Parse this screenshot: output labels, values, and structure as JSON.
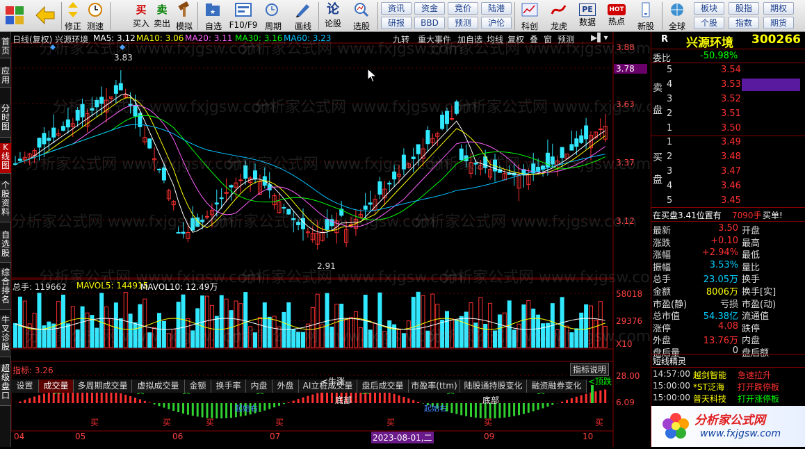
{
  "toolbar": {
    "buttons": [
      {
        "label": "",
        "name": "grid-icon"
      },
      {
        "label": "",
        "name": "back-arrow-icon"
      },
      {
        "label": "修正",
        "name": "updown-arrow-icon"
      },
      {
        "label": "测速",
        "name": "clock-icon"
      },
      {
        "label": "买入",
        "icon": "买",
        "name": "buy-icon"
      },
      {
        "label": "卖出",
        "icon": "卖",
        "name": "sell-icon"
      },
      {
        "label": "模拟",
        "name": "hammer-icon"
      },
      {
        "label": "自选",
        "name": "folder-star-icon"
      },
      {
        "label": "F10/F9",
        "name": "f10-icon"
      },
      {
        "label": "周期",
        "name": "cycle-icon"
      },
      {
        "label": "画线",
        "name": "pencil-icon"
      },
      {
        "label": "论股",
        "icon": "论",
        "name": "forum-icon"
      },
      {
        "label": "选股",
        "name": "magnifier-icon"
      }
    ],
    "navgrid": [
      [
        "资讯",
        "资金",
        "竞价",
        "陆港"
      ],
      [
        "研报",
        "BBD",
        "预测",
        "沪伦"
      ]
    ],
    "buttons2": [
      {
        "label": "科创",
        "name": "kechuang-icon"
      },
      {
        "label": "龙虎",
        "name": "dragon-icon"
      },
      {
        "label": "数据",
        "icon": "PE",
        "name": "pe-icon"
      },
      {
        "label": "热点",
        "icon": "HOT",
        "name": "hot-icon"
      },
      {
        "label": "新股",
        "name": "newstock-icon"
      },
      {
        "label": "全球",
        "name": "globe-icon"
      }
    ],
    "navgrid2": [
      [
        "板块",
        "股指",
        "期权"
      ],
      [
        "个股",
        "指数",
        "期货"
      ]
    ]
  },
  "lefttabs": [
    "首页",
    "应用",
    "分时图",
    "K线图",
    "个股资料",
    "自选股",
    "综合排名",
    "牛叉诊股",
    "超级盘口"
  ],
  "chart": {
    "legend": {
      "title": "日线(复权) 兴源环境",
      "ma5": "MA5: 3.12",
      "ma10": "MA10: 3.06",
      "ma20": "MA20: 3.11",
      "ma30": "MA30: 3.16",
      "ma60": "MA60: 3.23"
    },
    "topbtns": [
      "九转",
      "重大事件",
      "加自选",
      "均线",
      "复权",
      "叠",
      "窗",
      "预测"
    ],
    "price_axis": [
      "3.88",
      "3.78",
      "3.63",
      "3.37",
      "3.12"
    ],
    "high_label": "3.83",
    "low_label": "2.91",
    "vol_legend": {
      "total": "总手: 119662",
      "mavol5": "MAVOL5: 144915",
      "mavol10": "MAVOL10: 12.49万"
    },
    "vol_axis": [
      "58018",
      "29376",
      "X10"
    ],
    "tabs": [
      "设置",
      "成交量",
      "多周期成交量",
      "虚拟成交量",
      "金额",
      "换手率",
      "内盘",
      "外盘",
      "AI立桩成交量",
      "盘后成交量",
      "市盈率(ttm)",
      "陆股通持股变化",
      "融资融券变化"
    ],
    "ind_title": "指标: 3.26",
    "ind_btn": "指标说明",
    "ind_axis": [
      "28.00",
      "6.09"
    ],
    "dates": [
      "04",
      "05",
      "06",
      "07",
      "09",
      "10"
    ],
    "cursor_date": "2023-08-01,二",
    "signals": [
      "卖",
      "买",
      "卖",
      "买",
      "卖",
      "买",
      "卖",
      "买",
      "卖",
      "买",
      "卖",
      "买",
      "卖",
      "买",
      "卖"
    ],
    "annot": {
      "bull": "<牛涨",
      "bottom1": "底部",
      "bottom2": "底部",
      "start1": "起始右",
      "start2": "起始右",
      "top": "<顶跌"
    },
    "watermark": "分析家公式网 www.fxjgsw.com"
  },
  "right": {
    "r": "R",
    "name": "兴源环境",
    "code": "300266",
    "weibi_label": "委比",
    "weibi": "-50.98%",
    "sell_label": [
      "卖",
      "盘"
    ],
    "buy_label": [
      "买",
      "盘"
    ],
    "asks": [
      {
        "n": "5",
        "p": "3.54"
      },
      {
        "n": "4",
        "p": "3.53"
      },
      {
        "n": "3",
        "p": "3.52"
      },
      {
        "n": "2",
        "p": "3.51"
      },
      {
        "n": "1",
        "p": "3.50"
      }
    ],
    "bids": [
      {
        "n": "1",
        "p": "3.49"
      },
      {
        "n": "2",
        "p": "3.48"
      },
      {
        "n": "3",
        "p": "3.47"
      },
      {
        "n": "4",
        "p": "3.46"
      },
      {
        "n": "5",
        "p": "3.45"
      }
    ],
    "pos": "在买盘3.41位置有",
    "pos_vol": "7090手",
    "pos_act": "买单!",
    "stats": [
      [
        "最新",
        "3.50",
        "开盘"
      ],
      [
        "涨跌",
        "+0.10",
        "最高"
      ],
      [
        "涨幅",
        "+2.94%",
        "最低"
      ],
      [
        "振幅",
        "3.53%",
        "量比"
      ],
      [
        "总手",
        "23.05万",
        "换手"
      ],
      [
        "金额",
        "8006万",
        "换手[实]"
      ],
      [
        "市盈(静)",
        "亏损",
        "市盈(动)"
      ],
      [
        "总市值",
        "54.38亿",
        "流通值"
      ],
      [
        "涨停",
        "4.08",
        "跌停"
      ],
      [
        "外盘",
        "13.76万",
        "内盘"
      ],
      [
        "盘后量",
        "0",
        "盘后额"
      ]
    ],
    "spirit_title": "短线精灵",
    "spirits": [
      [
        "14:57:00",
        "越剑智能",
        "急速拉升"
      ],
      [
        "15:00:00",
        "*ST泛海",
        "打开跌停板"
      ],
      [
        "15:00:00",
        "普天科技",
        "打开涨停板"
      ]
    ],
    "brand": "分析家公式网",
    "url": "www.fxjgsw.com"
  }
}
